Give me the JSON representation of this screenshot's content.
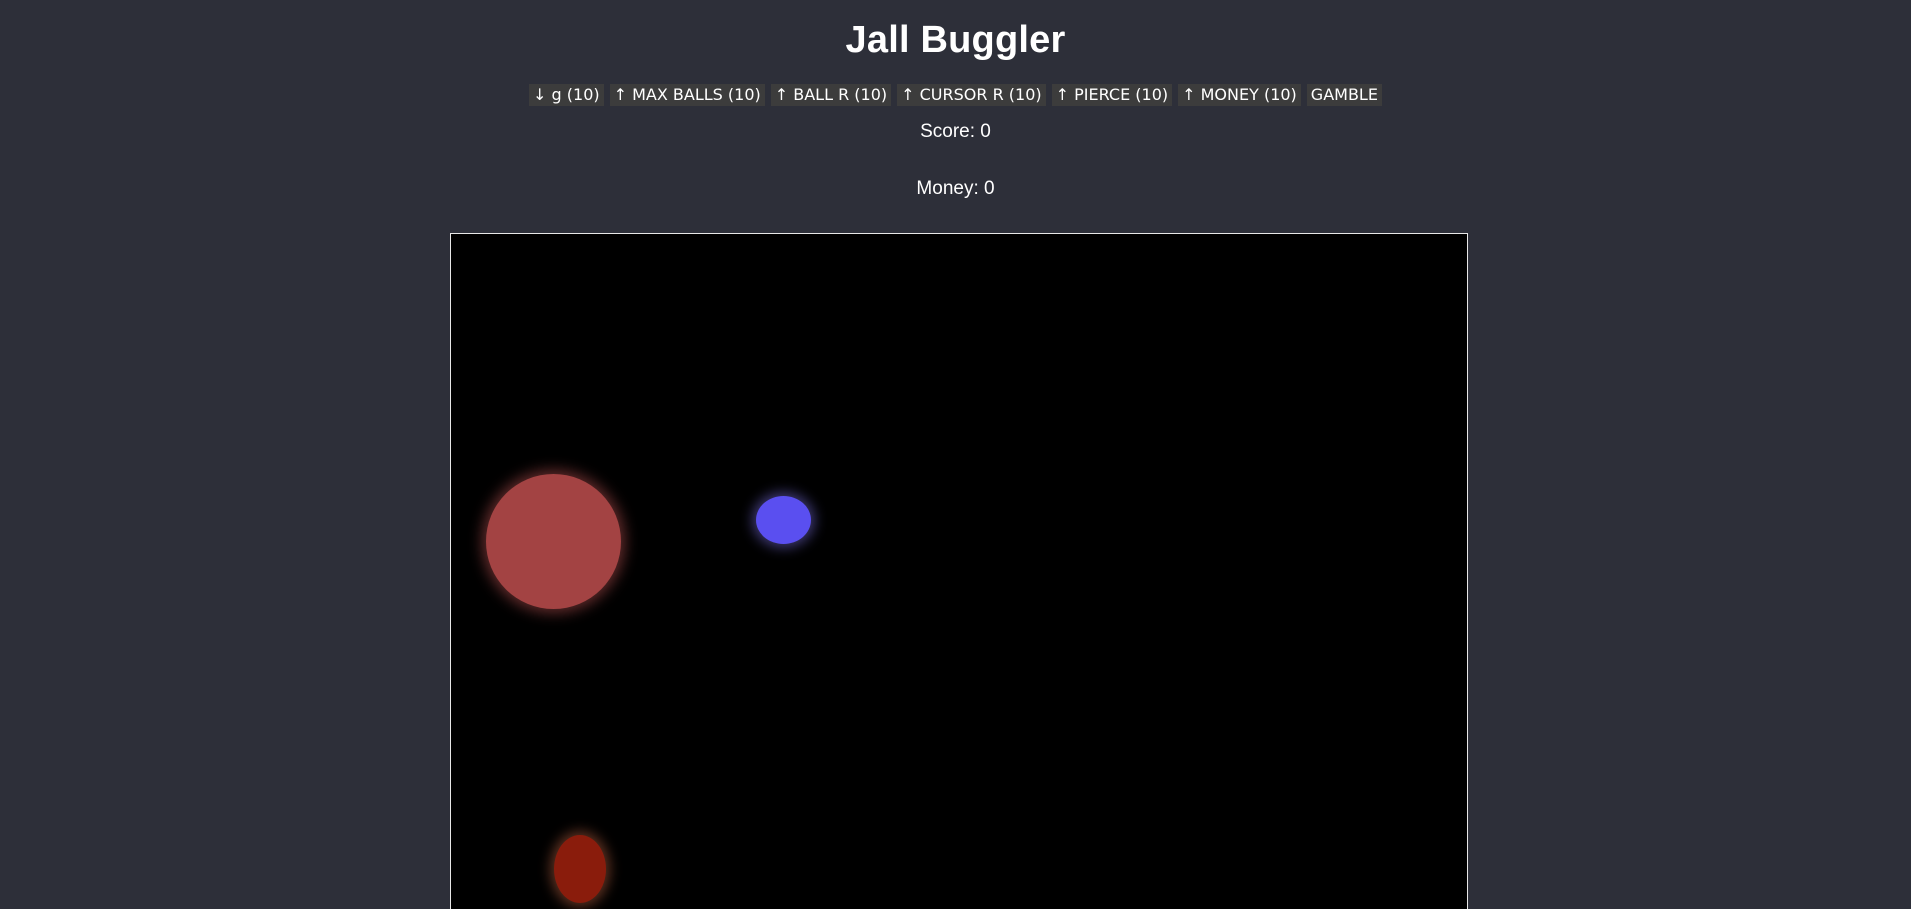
{
  "title": "Jall Buggler",
  "toolbar": {
    "buttons": [
      {
        "label": "↓ g (10)"
      },
      {
        "label": "↑ MAX BALLS (10)"
      },
      {
        "label": "↑ BALL R (10)"
      },
      {
        "label": "↑ CURSOR R (10)"
      },
      {
        "label": "↑ PIERCE (10)"
      },
      {
        "label": "↑ MONEY (10)"
      },
      {
        "label": "GAMBLE"
      }
    ]
  },
  "stats": {
    "score": "Score: 0",
    "money": "Money: 0"
  },
  "arena": {
    "balls": [
      {
        "name": "large-red-ball",
        "color": "#a34343"
      },
      {
        "name": "blue-cursor-ball",
        "color": "#5a4ff0"
      },
      {
        "name": "dark-red-ball",
        "color": "#8a1c0c"
      }
    ]
  },
  "colors": {
    "page_background": "#2d2f39",
    "button_background": "#3c3c3c",
    "arena_background": "#000000",
    "text": "#ffffff"
  }
}
